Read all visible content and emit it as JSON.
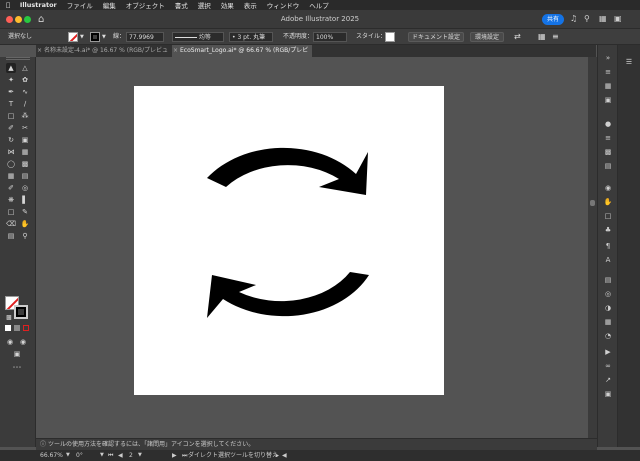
{
  "menubar": {
    "apple": "",
    "app_name": "Illustrator",
    "items": [
      "ファイル",
      "編集",
      "オブジェクト",
      "書式",
      "選択",
      "効果",
      "表示",
      "ウィンドウ",
      "ヘルプ"
    ]
  },
  "window": {
    "title": "Adobe Illustrator 2025",
    "share_label": "共有"
  },
  "control_bar": {
    "selection_label": "選択なし",
    "stroke_label": "線：",
    "stroke_weight": "77.9969",
    "stroke_profile": "均等",
    "brush": "3 pt. 丸筆",
    "opacity_label": "不透明度：",
    "opacity_value": "100%",
    "style_label": "スタイル：",
    "document_setup": "ドキュメント設定",
    "preferences": "環境設定"
  },
  "tabs": [
    {
      "label": "名称未設定-4.ai* @ 16.67 % (RGB/プレビュー)",
      "active": false
    },
    {
      "label": "EcoSmart_Logo.ai* @ 66.67 % (RGB/プレビュー)",
      "active": true
    }
  ],
  "status": {
    "hint": "ツールの使用方法を確認するには、「諸問用」アイコンを選択してください。"
  },
  "bottom": {
    "zoom": "66.67%",
    "rotation": "0°",
    "artboard_number": "2",
    "current_tool": "ダイレクト選択ツールを切り替え"
  },
  "colors": {
    "accent": "#1473e6",
    "chrome": "#3b3b3b",
    "canvas": "#535353",
    "artwork": "#000000"
  }
}
